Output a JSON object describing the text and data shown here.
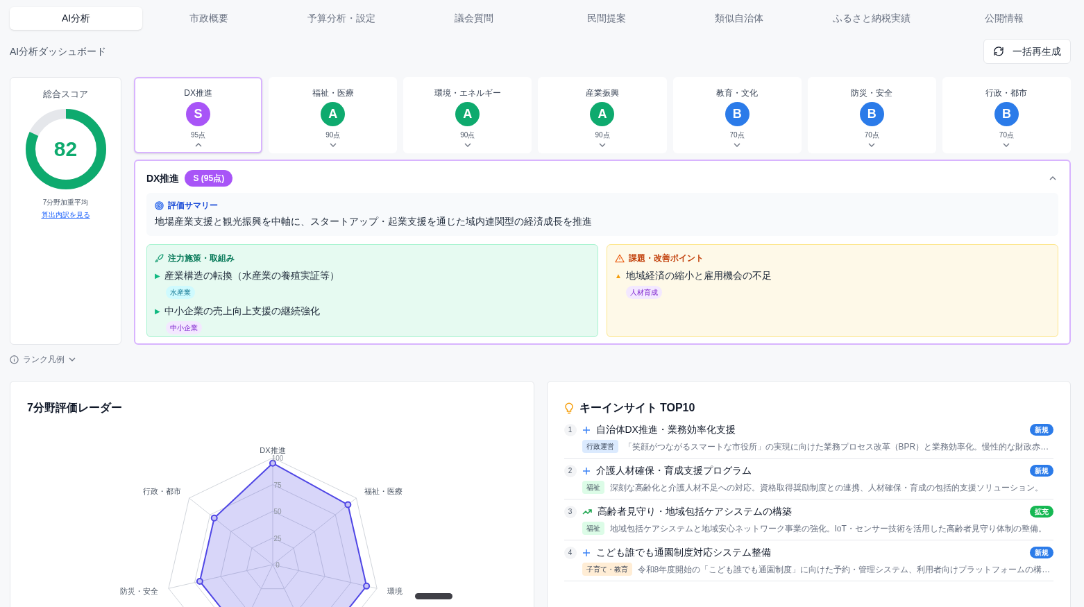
{
  "tabs": [
    {
      "label": "AI分析",
      "selected": true
    },
    {
      "label": "市政概要",
      "selected": false
    },
    {
      "label": "予算分析・設定",
      "selected": false
    },
    {
      "label": "議会質問",
      "selected": false
    },
    {
      "label": "民間提案",
      "selected": false
    },
    {
      "label": "類似自治体",
      "selected": false
    },
    {
      "label": "ふるさと納税実績",
      "selected": false
    },
    {
      "label": "公開情報",
      "selected": false
    }
  ],
  "header": {
    "title": "AI分析ダッシュボード",
    "regenerate_button": "一括再生成"
  },
  "score": {
    "label": "総合スコア",
    "value": "82",
    "level": 0.82,
    "caption": "7分野加重平均",
    "link": "算出内訳を見る"
  },
  "categories": [
    {
      "name": "DX推進",
      "rank": "S",
      "score": "95点",
      "color": "#a855f7",
      "selected": true
    },
    {
      "name": "福祉・医療",
      "rank": "A",
      "score": "90点",
      "color": "#0eaa6e",
      "selected": false
    },
    {
      "name": "環境・エネルギー",
      "rank": "A",
      "score": "90点",
      "color": "#0eaa6e",
      "selected": false
    },
    {
      "name": "産業振興",
      "rank": "A",
      "score": "90点",
      "color": "#0eaa6e",
      "selected": false
    },
    {
      "name": "教育・文化",
      "rank": "B",
      "score": "70点",
      "color": "#2b7be9",
      "selected": false
    },
    {
      "name": "防災・安全",
      "rank": "B",
      "score": "70点",
      "color": "#2b7be9",
      "selected": false
    },
    {
      "name": "行政・都市",
      "rank": "B",
      "score": "70点",
      "color": "#2b7be9",
      "selected": false
    }
  ],
  "detail": {
    "title": "DX推進",
    "badge": "S (95点)",
    "expanded": true,
    "summary": {
      "heading": "評価サマリー",
      "text": "地場産業支援と観光振興を中軸に、スタートアップ・起業支援を通じた域内連関型の経済成長を推進"
    },
    "focus": {
      "heading": "注力施策・取組み",
      "items": [
        {
          "bullet": "▶",
          "text": "産業構造の転換（水産業の養殖実証等）",
          "tag": "水産業",
          "color": "#cffafe"
        },
        {
          "bullet": "▶",
          "text": "中小企業の売上向上支援の継続強化",
          "tag": "中小企業",
          "color": "#f3e8ff"
        }
      ]
    },
    "issues": {
      "heading": "課題・改善ポイント",
      "items": [
        {
          "bullet": "▲",
          "text": "地域経済の縮小と雇用機会の不足",
          "tag": "人材育成",
          "color": "#f3e8ff"
        }
      ]
    }
  },
  "legend": {
    "label": "ランク凡例",
    "expanded": false
  },
  "radar": {
    "title": "7分野評価レーダー",
    "ticks": [
      "100",
      "75",
      "50",
      "25",
      "0"
    ],
    "axes": [
      "DX推進",
      "福祉・医療",
      "環境",
      "防災・安全",
      "行政・都市"
    ]
  },
  "insights": {
    "title": "キーインサイト TOP10",
    "items": [
      {
        "rank": "1",
        "kind": "new",
        "title": "自治体DX推進・業務効率化支援",
        "category": {
          "label": "行政運営",
          "color": "#dbeafe"
        },
        "description": "「笑顔がつながるスマートな市役所」の実現に向けた業務プロセス改革（BPR）と業務効率化。慢性的な財政赤…",
        "badge": {
          "label": "新規",
          "color": "#2b7be9"
        }
      },
      {
        "rank": "2",
        "kind": "new",
        "title": "介護人材確保・育成支援プログラム",
        "category": {
          "label": "福祉",
          "color": "#dcfce7"
        },
        "description": "深刻な高齢化と介護人材不足への対応。資格取得奨励制度との連携、人材確保・育成の包括的支援ソリューション。",
        "badge": {
          "label": "新規",
          "color": "#2b7be9"
        }
      },
      {
        "rank": "3",
        "kind": "expand",
        "title": "高齢者見守り・地域包括ケアシステムの構築",
        "category": {
          "label": "福祉",
          "color": "#dcfce7"
        },
        "description": "地域包括ケアシステムと地域安心ネットワーク事業の強化。IoT・センサー技術を活用した高齢者見守り体制の整備。",
        "badge": {
          "label": "拡充",
          "color": "#16b853"
        }
      },
      {
        "rank": "4",
        "kind": "new",
        "title": "こども誰でも通園制度対応システム整備",
        "category": {
          "label": "子育て・教育",
          "color": "#ffedd5"
        },
        "description": "令和8年度開始の「こども誰でも通園制度」に向けた予約・管理システム、利用者向けプラットフォームの構…",
        "badge": {
          "label": "新規",
          "color": "#2b7be9"
        }
      }
    ]
  }
}
